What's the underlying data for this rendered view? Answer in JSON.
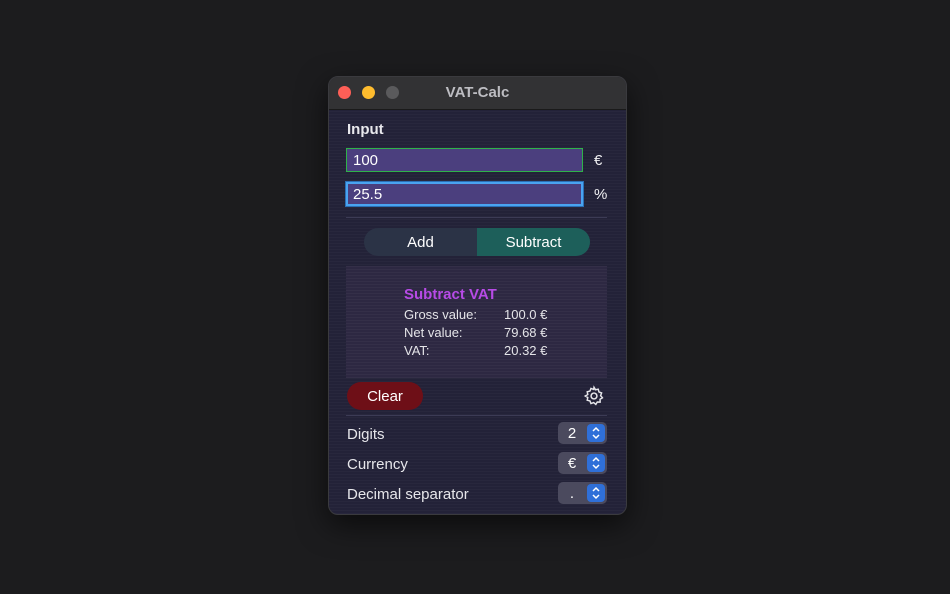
{
  "window": {
    "title": "VAT-Calc"
  },
  "input": {
    "section_label": "Input",
    "amount_value": "100",
    "amount_unit": "€",
    "rate_value": "25.5",
    "rate_unit": "%"
  },
  "mode": {
    "options": [
      "Add",
      "Subtract"
    ],
    "selected": "Subtract"
  },
  "result": {
    "title": "Subtract VAT",
    "rows": [
      {
        "label": "Gross value:",
        "value": "100.0 €"
      },
      {
        "label": "Net value:",
        "value": "79.68 €"
      },
      {
        "label": "VAT:",
        "value": "20.32 €"
      }
    ]
  },
  "actions": {
    "clear_label": "Clear"
  },
  "settings": [
    {
      "label": "Digits",
      "value": "2"
    },
    {
      "label": "Currency",
      "value": "€"
    },
    {
      "label": "Decimal separator",
      "value": "."
    }
  ],
  "colors": {
    "accent_add_subtract": "#1d5f5a",
    "result_title": "#b74be6",
    "clear_button": "#6e0f17",
    "stepper_arrow": "#2f6fd8"
  },
  "icons": {
    "close": "close-icon",
    "minimize": "minimize-icon",
    "zoom": "zoom-icon",
    "settings": "gear-icon",
    "stepper": "up-down-chevron-icon"
  }
}
